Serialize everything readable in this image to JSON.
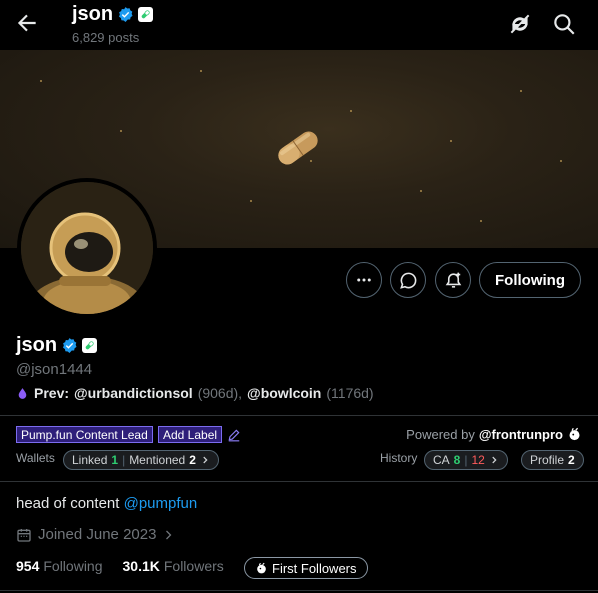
{
  "header": {
    "name": "json",
    "posts": "6,829 posts"
  },
  "profile": {
    "name": "json",
    "handle": "@json1444",
    "prev_label": "Prev:",
    "prev_account1": "@urbandictionsol",
    "prev_age1": "(906d),",
    "prev_account2": "@bowlcoin",
    "prev_age2": "(1176d)",
    "follow_button": "Following"
  },
  "frontrun": {
    "tag1": "Pump.fun Content Lead",
    "tag2": "Add Label",
    "powered_label": "Powered by",
    "powered_handle": "@frontrunpro",
    "wallets_label": "Wallets",
    "linked_label": "Linked",
    "linked_count": "1",
    "mentioned_label": "Mentioned",
    "mentioned_count": "2",
    "history_label": "History",
    "ca_label": "CA",
    "ca_green": "8",
    "ca_red": "12",
    "profile_label": "Profile",
    "profile_count": "2"
  },
  "bio": {
    "text": "head of content",
    "mention": "@pumpfun"
  },
  "joined": "Joined June 2023",
  "stats": {
    "following_count": "954",
    "following_label": "Following",
    "followers_count": "30.1K",
    "followers_label": "Followers",
    "first_followers": "First Followers"
  },
  "colors": {
    "accent": "#1d9bf0",
    "tag_bg": "#2e1f7a",
    "green": "#2ecc71",
    "red": "#ff5c5c"
  },
  "icons": [
    "back-arrow-icon",
    "verified-icon",
    "pill-badge-icon",
    "no-sync-icon",
    "search-icon",
    "more-icon",
    "message-icon",
    "notification-plus-icon",
    "edit-icon",
    "calendar-icon",
    "chevron-right-icon",
    "frontrun-logo-icon"
  ]
}
